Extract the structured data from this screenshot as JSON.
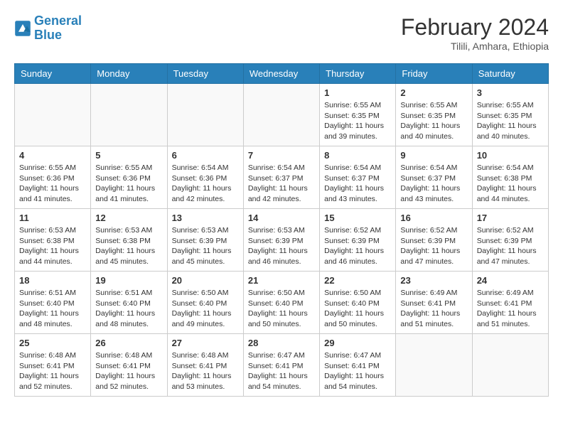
{
  "header": {
    "logo_line1": "General",
    "logo_line2": "Blue",
    "month_year": "February 2024",
    "location": "Tilili, Amhara, Ethiopia"
  },
  "days_of_week": [
    "Sunday",
    "Monday",
    "Tuesday",
    "Wednesday",
    "Thursday",
    "Friday",
    "Saturday"
  ],
  "weeks": [
    [
      {
        "num": "",
        "info": ""
      },
      {
        "num": "",
        "info": ""
      },
      {
        "num": "",
        "info": ""
      },
      {
        "num": "",
        "info": ""
      },
      {
        "num": "1",
        "info": "Sunrise: 6:55 AM\nSunset: 6:35 PM\nDaylight: 11 hours\nand 39 minutes."
      },
      {
        "num": "2",
        "info": "Sunrise: 6:55 AM\nSunset: 6:35 PM\nDaylight: 11 hours\nand 40 minutes."
      },
      {
        "num": "3",
        "info": "Sunrise: 6:55 AM\nSunset: 6:35 PM\nDaylight: 11 hours\nand 40 minutes."
      }
    ],
    [
      {
        "num": "4",
        "info": "Sunrise: 6:55 AM\nSunset: 6:36 PM\nDaylight: 11 hours\nand 41 minutes."
      },
      {
        "num": "5",
        "info": "Sunrise: 6:55 AM\nSunset: 6:36 PM\nDaylight: 11 hours\nand 41 minutes."
      },
      {
        "num": "6",
        "info": "Sunrise: 6:54 AM\nSunset: 6:36 PM\nDaylight: 11 hours\nand 42 minutes."
      },
      {
        "num": "7",
        "info": "Sunrise: 6:54 AM\nSunset: 6:37 PM\nDaylight: 11 hours\nand 42 minutes."
      },
      {
        "num": "8",
        "info": "Sunrise: 6:54 AM\nSunset: 6:37 PM\nDaylight: 11 hours\nand 43 minutes."
      },
      {
        "num": "9",
        "info": "Sunrise: 6:54 AM\nSunset: 6:37 PM\nDaylight: 11 hours\nand 43 minutes."
      },
      {
        "num": "10",
        "info": "Sunrise: 6:54 AM\nSunset: 6:38 PM\nDaylight: 11 hours\nand 44 minutes."
      }
    ],
    [
      {
        "num": "11",
        "info": "Sunrise: 6:53 AM\nSunset: 6:38 PM\nDaylight: 11 hours\nand 44 minutes."
      },
      {
        "num": "12",
        "info": "Sunrise: 6:53 AM\nSunset: 6:38 PM\nDaylight: 11 hours\nand 45 minutes."
      },
      {
        "num": "13",
        "info": "Sunrise: 6:53 AM\nSunset: 6:39 PM\nDaylight: 11 hours\nand 45 minutes."
      },
      {
        "num": "14",
        "info": "Sunrise: 6:53 AM\nSunset: 6:39 PM\nDaylight: 11 hours\nand 46 minutes."
      },
      {
        "num": "15",
        "info": "Sunrise: 6:52 AM\nSunset: 6:39 PM\nDaylight: 11 hours\nand 46 minutes."
      },
      {
        "num": "16",
        "info": "Sunrise: 6:52 AM\nSunset: 6:39 PM\nDaylight: 11 hours\nand 47 minutes."
      },
      {
        "num": "17",
        "info": "Sunrise: 6:52 AM\nSunset: 6:39 PM\nDaylight: 11 hours\nand 47 minutes."
      }
    ],
    [
      {
        "num": "18",
        "info": "Sunrise: 6:51 AM\nSunset: 6:40 PM\nDaylight: 11 hours\nand 48 minutes."
      },
      {
        "num": "19",
        "info": "Sunrise: 6:51 AM\nSunset: 6:40 PM\nDaylight: 11 hours\nand 48 minutes."
      },
      {
        "num": "20",
        "info": "Sunrise: 6:50 AM\nSunset: 6:40 PM\nDaylight: 11 hours\nand 49 minutes."
      },
      {
        "num": "21",
        "info": "Sunrise: 6:50 AM\nSunset: 6:40 PM\nDaylight: 11 hours\nand 50 minutes."
      },
      {
        "num": "22",
        "info": "Sunrise: 6:50 AM\nSunset: 6:40 PM\nDaylight: 11 hours\nand 50 minutes."
      },
      {
        "num": "23",
        "info": "Sunrise: 6:49 AM\nSunset: 6:41 PM\nDaylight: 11 hours\nand 51 minutes."
      },
      {
        "num": "24",
        "info": "Sunrise: 6:49 AM\nSunset: 6:41 PM\nDaylight: 11 hours\nand 51 minutes."
      }
    ],
    [
      {
        "num": "25",
        "info": "Sunrise: 6:48 AM\nSunset: 6:41 PM\nDaylight: 11 hours\nand 52 minutes."
      },
      {
        "num": "26",
        "info": "Sunrise: 6:48 AM\nSunset: 6:41 PM\nDaylight: 11 hours\nand 52 minutes."
      },
      {
        "num": "27",
        "info": "Sunrise: 6:48 AM\nSunset: 6:41 PM\nDaylight: 11 hours\nand 53 minutes."
      },
      {
        "num": "28",
        "info": "Sunrise: 6:47 AM\nSunset: 6:41 PM\nDaylight: 11 hours\nand 54 minutes."
      },
      {
        "num": "29",
        "info": "Sunrise: 6:47 AM\nSunset: 6:41 PM\nDaylight: 11 hours\nand 54 minutes."
      },
      {
        "num": "",
        "info": ""
      },
      {
        "num": "",
        "info": ""
      }
    ]
  ]
}
